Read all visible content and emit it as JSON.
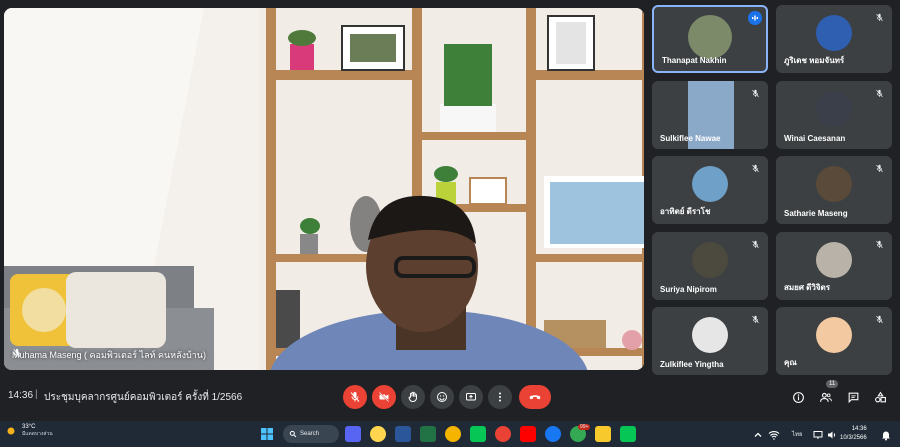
{
  "main": {
    "name": "Muhama Maseng ( คอมพิวเตอร์ ไลท์ คนหลังบ้าน)"
  },
  "participants": [
    {
      "name": "Thanapat Nakhin",
      "status": "speaking"
    },
    {
      "name": "ภูริเดช หอมจันทร์",
      "status": "muted"
    },
    {
      "name": "Sulkiflee Nawae",
      "status": "muted"
    },
    {
      "name": "Winai Caesanan",
      "status": "muted"
    },
    {
      "name": "อาทิตย์ ดีราโช",
      "status": "muted"
    },
    {
      "name": "Satharie Maseng",
      "status": "muted"
    },
    {
      "name": "Suriya Nipirom",
      "status": "muted"
    },
    {
      "name": "สมยศ ดีวิจิตร",
      "status": "muted"
    },
    {
      "name": "Zulkiflee Yingtha",
      "status": "muted"
    },
    {
      "name": "คุณ",
      "status": "muted"
    }
  ],
  "meeting": {
    "time": "14:36",
    "separator": "|",
    "title": "ประชุมบุคลากรศูนย์คอมพิวเตอร์ ครั้งที่ 1/2566",
    "people_count": "11"
  },
  "taskbar": {
    "weather_temp": "33°C",
    "weather_desc": "มีแดดบางส่วน",
    "search_label": "Search",
    "lang": "ไทย",
    "clock_time": "14:36",
    "clock_date": "10/3/2566",
    "store_badge": "99+"
  },
  "colors": {
    "background": "#202124",
    "tile": "#3c4043",
    "accent": "#8ab4f8",
    "danger": "#ea4335"
  }
}
